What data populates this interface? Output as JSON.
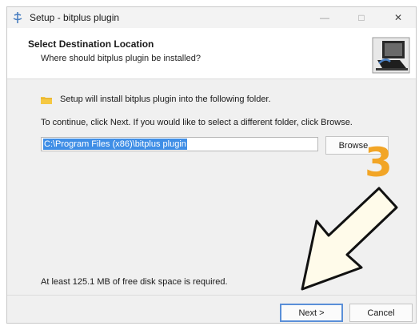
{
  "window": {
    "title": "Setup - bitplus plugin",
    "controls": {
      "minimize": "—",
      "maximize": "□",
      "close": "✕"
    }
  },
  "header": {
    "title": "Select Destination Location",
    "subtitle": "Where should bitplus plugin be installed?",
    "logo_icon": "computer-install-icon"
  },
  "content": {
    "install_line": "Setup will install bitplus plugin into the following folder.",
    "continue_line": "To continue, click Next. If you would like to select a different folder, click Browse.",
    "path_value": "C:\\Program Files (x86)\\bitplus plugin",
    "browse_label": "Browse...",
    "disk_space": "At least 125.1 MB of free disk space is required."
  },
  "footer": {
    "next_label": "Next >",
    "cancel_label": "Cancel"
  },
  "annotation": {
    "step_number": "3",
    "arrow_icon": "pointer-arrow-icon",
    "color": "#f2a526"
  },
  "colors": {
    "selection": "#3f8ee6",
    "default_button_border": "#5a8fd8",
    "folder": "#f5c842"
  }
}
